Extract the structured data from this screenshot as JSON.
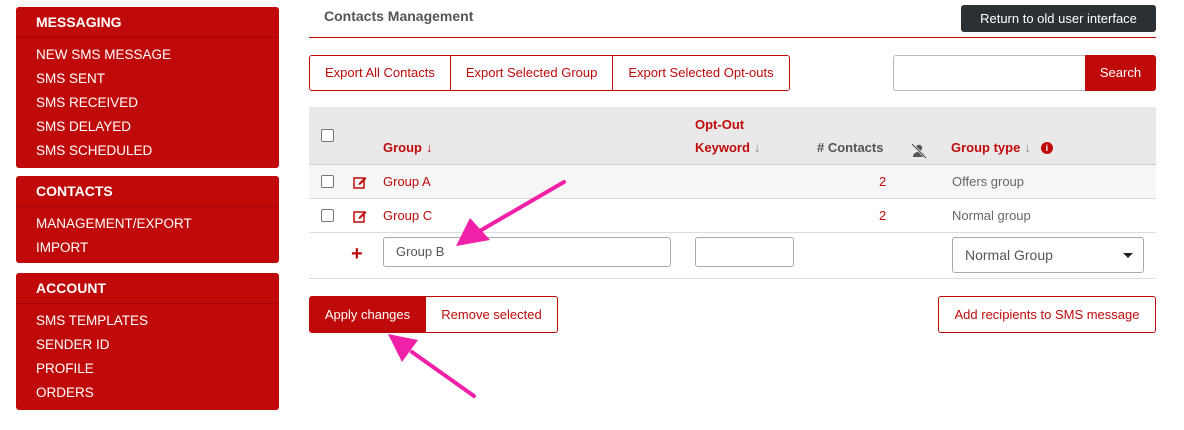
{
  "sidebar": {
    "messaging": {
      "title": "MESSAGING",
      "items": [
        "NEW SMS MESSAGE",
        "SMS SENT",
        "SMS RECEIVED",
        "SMS DELAYED",
        "SMS SCHEDULED"
      ]
    },
    "contacts": {
      "title": "CONTACTS",
      "items": [
        "MANAGEMENT/EXPORT",
        "IMPORT"
      ]
    },
    "account": {
      "title": "ACCOUNT",
      "items": [
        "SMS TEMPLATES",
        "SENDER ID",
        "PROFILE",
        "ORDERS"
      ]
    }
  },
  "main": {
    "title": "Contacts Management",
    "old_ui_label": "Return to old user interface",
    "export_buttons": [
      "Export All Contacts",
      "Export Selected Group",
      "Export Selected Opt-outs"
    ],
    "search": {
      "value": "",
      "button_label": "Search"
    }
  },
  "table": {
    "headers": {
      "group": "Group",
      "optout_line1": "Opt-Out",
      "optout_line2": "Keyword",
      "contacts": "# Contacts",
      "group_type": "Group type"
    },
    "rows": [
      {
        "group": "Group A",
        "contacts": "2",
        "type": "Offers group"
      },
      {
        "group": "Group C",
        "contacts": "2",
        "type": "Normal group"
      }
    ],
    "new_row": {
      "group_value": "Group B",
      "keyword_value": "",
      "type_value": "Normal Group"
    }
  },
  "actions": {
    "apply": "Apply changes",
    "remove": "Remove selected",
    "add_recipients": "Add recipients to SMS message"
  },
  "icons": {
    "sort_arrow": "arrow-down-icon",
    "edit": "edit-icon",
    "add": "plus-icon",
    "info": "info-icon",
    "hidden_user": "user-slash-icon"
  },
  "colors": {
    "accent": "#c00a0a",
    "dark_button": "#2b3035",
    "annotation_arrow": "#f020a8"
  }
}
